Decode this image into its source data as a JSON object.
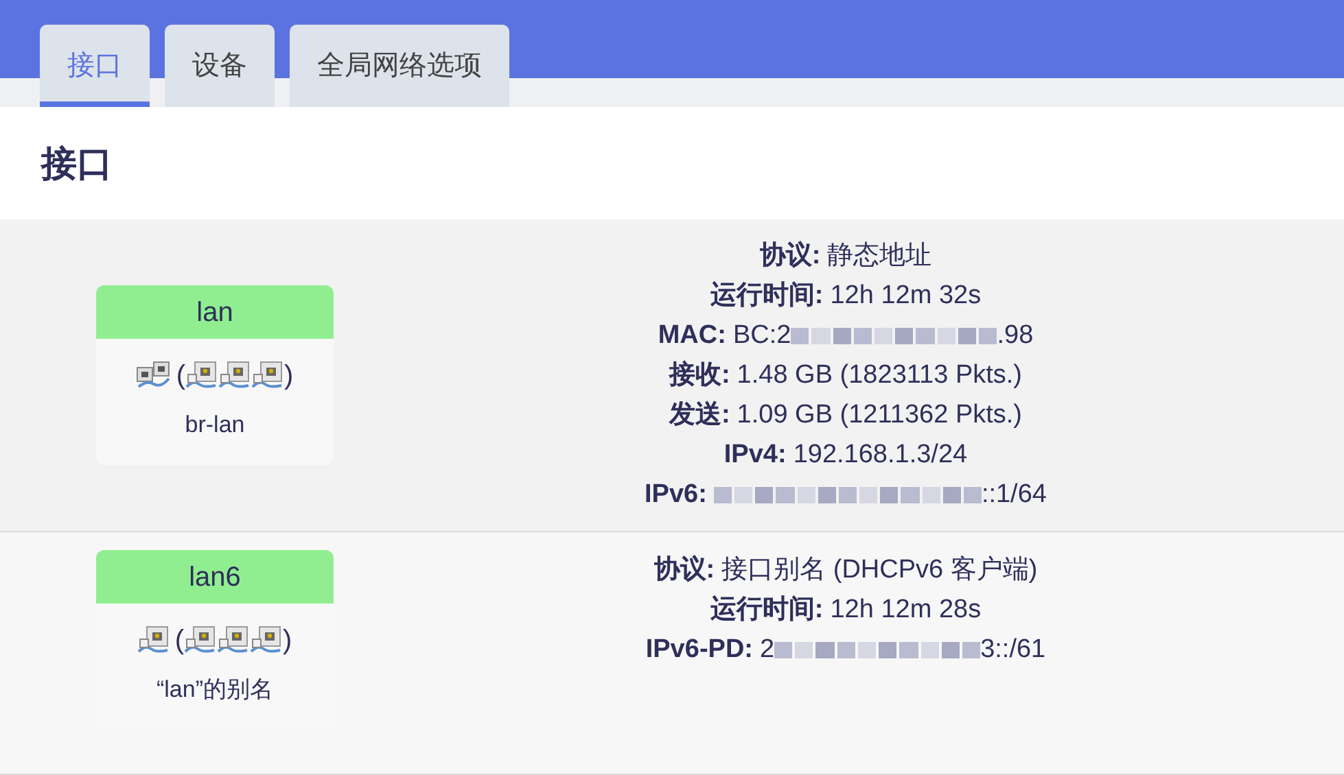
{
  "tabs": [
    {
      "label": "接口",
      "selected": true
    },
    {
      "label": "设备",
      "selected": false
    },
    {
      "label": "全局网络选项",
      "selected": false
    }
  ],
  "heading": "接口",
  "interfaces": [
    {
      "name": "lan",
      "kind": "bridge",
      "open": "(",
      "ports": [
        {
          "kind": "ethernet"
        },
        {
          "kind": "ethernet"
        },
        {
          "kind": "ethernet"
        }
      ],
      "close": ")",
      "device": "br-lan",
      "details": [
        {
          "kind": "text",
          "label": "协议:",
          "value": "静态地址"
        },
        {
          "kind": "text",
          "label": "运行时间:",
          "value": "12h 12m 32s"
        },
        {
          "kind": "redacted",
          "label": "MAC:",
          "prefix": "BC:2",
          "suffix": ".98"
        },
        {
          "kind": "text",
          "label": "接收:",
          "value": "1.48 GB (1823113 Pkts.)"
        },
        {
          "kind": "text",
          "label": "发送:",
          "value": "1.09 GB (1211362 Pkts.)"
        },
        {
          "kind": "text",
          "label": "IPv4:",
          "value": "192.168.1.3/24"
        },
        {
          "kind": "redacted",
          "label": "IPv6:",
          "suffix": "::1/64"
        }
      ]
    },
    {
      "name": "lan6",
      "kind": "alias",
      "open": "(",
      "ports": [
        {
          "kind": "ethernet"
        },
        {
          "kind": "ethernet"
        },
        {
          "kind": "ethernet"
        }
      ],
      "close": ")",
      "device": "“lan”的别名",
      "details": [
        {
          "kind": "text",
          "label": "协议:",
          "value": "接口别名 (DHCPv6 客户端)"
        },
        {
          "kind": "text",
          "label": "运行时间:",
          "value": "12h 12m 28s"
        },
        {
          "kind": "redacted",
          "label": "IPv6-PD:",
          "prefix": "2",
          "suffix": "3::/61"
        }
      ]
    }
  ]
}
